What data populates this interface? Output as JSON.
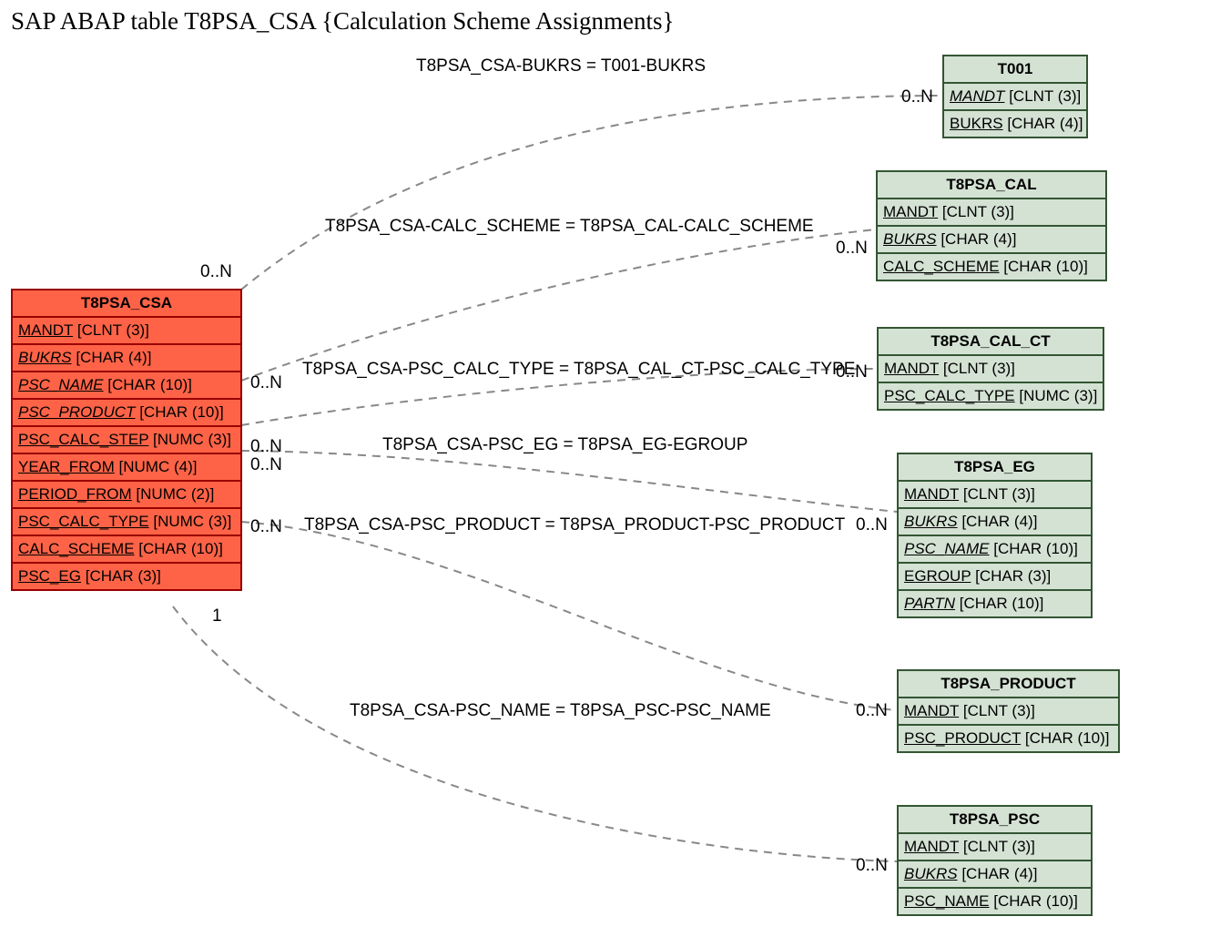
{
  "title": "SAP ABAP table T8PSA_CSA {Calculation Scheme Assignments}",
  "main_entity": {
    "name": "T8PSA_CSA",
    "fields": [
      {
        "name": "MANDT",
        "type": "[CLNT (3)]",
        "italic": false
      },
      {
        "name": "BUKRS",
        "type": "[CHAR (4)]",
        "italic": true
      },
      {
        "name": "PSC_NAME",
        "type": "[CHAR (10)]",
        "italic": true
      },
      {
        "name": "PSC_PRODUCT",
        "type": "[CHAR (10)]",
        "italic": true
      },
      {
        "name": "PSC_CALC_STEP",
        "type": "[NUMC (3)]",
        "italic": false
      },
      {
        "name": "YEAR_FROM",
        "type": "[NUMC (4)]",
        "italic": false
      },
      {
        "name": "PERIOD_FROM",
        "type": "[NUMC (2)]",
        "italic": false
      },
      {
        "name": "PSC_CALC_TYPE",
        "type": "[NUMC (3)]",
        "italic": false
      },
      {
        "name": "CALC_SCHEME",
        "type": "[CHAR (10)]",
        "italic": false
      },
      {
        "name": "PSC_EG",
        "type": "[CHAR (3)]",
        "italic": false
      }
    ]
  },
  "related": {
    "t001": {
      "name": "T001",
      "fields": [
        {
          "name": "MANDT",
          "type": "[CLNT (3)]",
          "italic": true
        },
        {
          "name": "BUKRS",
          "type": "[CHAR (4)]",
          "italic": false
        }
      ]
    },
    "t8psa_cal": {
      "name": "T8PSA_CAL",
      "fields": [
        {
          "name": "MANDT",
          "type": "[CLNT (3)]",
          "italic": false
        },
        {
          "name": "BUKRS",
          "type": "[CHAR (4)]",
          "italic": true
        },
        {
          "name": "CALC_SCHEME",
          "type": "[CHAR (10)]",
          "italic": false
        }
      ]
    },
    "t8psa_cal_ct": {
      "name": "T8PSA_CAL_CT",
      "fields": [
        {
          "name": "MANDT",
          "type": "[CLNT (3)]",
          "italic": false
        },
        {
          "name": "PSC_CALC_TYPE",
          "type": "[NUMC (3)]",
          "italic": false
        }
      ]
    },
    "t8psa_eg": {
      "name": "T8PSA_EG",
      "fields": [
        {
          "name": "MANDT",
          "type": "[CLNT (3)]",
          "italic": false
        },
        {
          "name": "BUKRS",
          "type": "[CHAR (4)]",
          "italic": true
        },
        {
          "name": "PSC_NAME",
          "type": "[CHAR (10)]",
          "italic": true
        },
        {
          "name": "EGROUP",
          "type": "[CHAR (3)]",
          "italic": false
        },
        {
          "name": "PARTN",
          "type": "[CHAR (10)]",
          "italic": true
        }
      ]
    },
    "t8psa_product": {
      "name": "T8PSA_PRODUCT",
      "fields": [
        {
          "name": "MANDT",
          "type": "[CLNT (3)]",
          "italic": false
        },
        {
          "name": "PSC_PRODUCT",
          "type": "[CHAR (10)]",
          "italic": false
        }
      ]
    },
    "t8psa_psc": {
      "name": "T8PSA_PSC",
      "fields": [
        {
          "name": "MANDT",
          "type": "[CLNT (3)]",
          "italic": false
        },
        {
          "name": "BUKRS",
          "type": "[CHAR (4)]",
          "italic": true
        },
        {
          "name": "PSC_NAME",
          "type": "[CHAR (10)]",
          "italic": false
        }
      ]
    }
  },
  "relations": {
    "r1": {
      "text": "T8PSA_CSA-BUKRS = T001-BUKRS",
      "left_card": "0..N",
      "right_card": "0..N"
    },
    "r2": {
      "text": "T8PSA_CSA-CALC_SCHEME = T8PSA_CAL-CALC_SCHEME",
      "left_card": "0..N",
      "right_card": "0..N"
    },
    "r3": {
      "text": "T8PSA_CSA-PSC_CALC_TYPE = T8PSA_CAL_CT-PSC_CALC_TYPE",
      "left_card": "0..N",
      "right_card": "0..N"
    },
    "r4": {
      "text": "T8PSA_CSA-PSC_EG = T8PSA_EG-EGROUP",
      "left_card": "0..N",
      "right_card": ""
    },
    "r5": {
      "text": "T8PSA_CSA-PSC_PRODUCT = T8PSA_PRODUCT-PSC_PRODUCT",
      "left_card": "0..N",
      "right_card": "0..N"
    },
    "r6": {
      "text": "T8PSA_CSA-PSC_NAME = T8PSA_PSC-PSC_NAME",
      "left_card": "1",
      "right_card": "0..N"
    }
  }
}
